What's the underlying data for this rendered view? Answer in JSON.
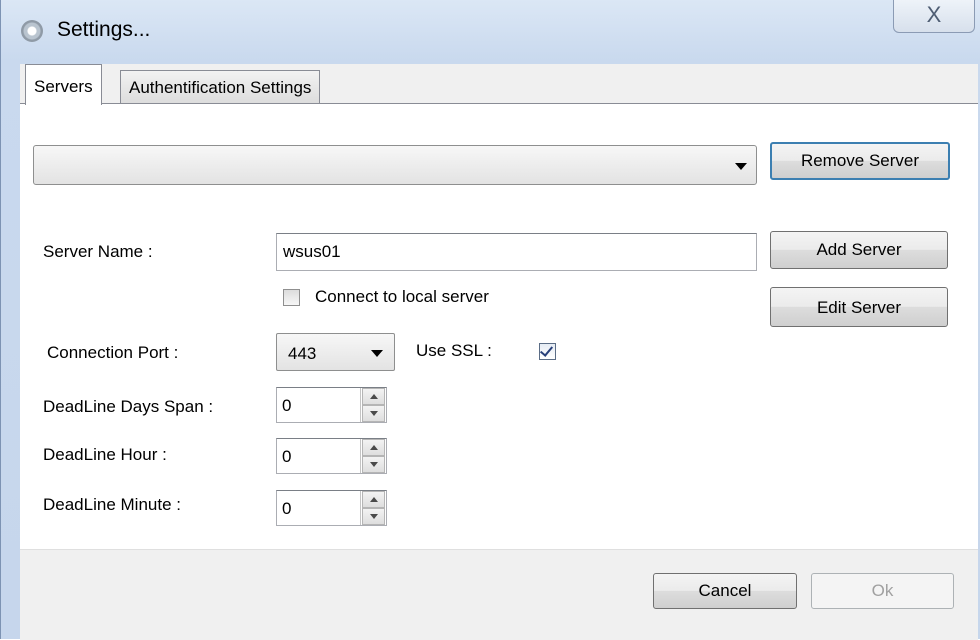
{
  "window": {
    "title": "Settings...",
    "close_glyph": "X"
  },
  "tabs": [
    {
      "label": "Servers",
      "active": true
    },
    {
      "label": "Authentification Settings",
      "active": false
    }
  ],
  "servers": {
    "server_combo_value": "",
    "remove_button": "Remove Server",
    "add_button": "Add Server",
    "edit_button": "Edit Server",
    "server_name_label": "Server Name :",
    "server_name_value": "wsus01",
    "local_server_label": "Connect to local server",
    "local_server_checked": false,
    "port_label": "Connection Port :",
    "port_value": "443",
    "ssl_label": "Use SSL :",
    "ssl_checked": true,
    "deadline_days_label": "DeadLine Days Span :",
    "deadline_days_value": "0",
    "deadline_hour_label": "DeadLine Hour :",
    "deadline_hour_value": "0",
    "deadline_minute_label": "DeadLine Minute :",
    "deadline_minute_value": "0"
  },
  "footer": {
    "cancel_button": "Cancel",
    "ok_button": "Ok"
  },
  "colors": {
    "focus_border": "#3c7fb1",
    "title_gradient_top": "#dbe7f5",
    "disabled_text": "#a0a0a0"
  },
  "icons": [
    "settings-gear-icon",
    "close-icon",
    "dropdown-arrow-icon",
    "checkmark-icon",
    "spin-up-icon",
    "spin-down-icon"
  ]
}
